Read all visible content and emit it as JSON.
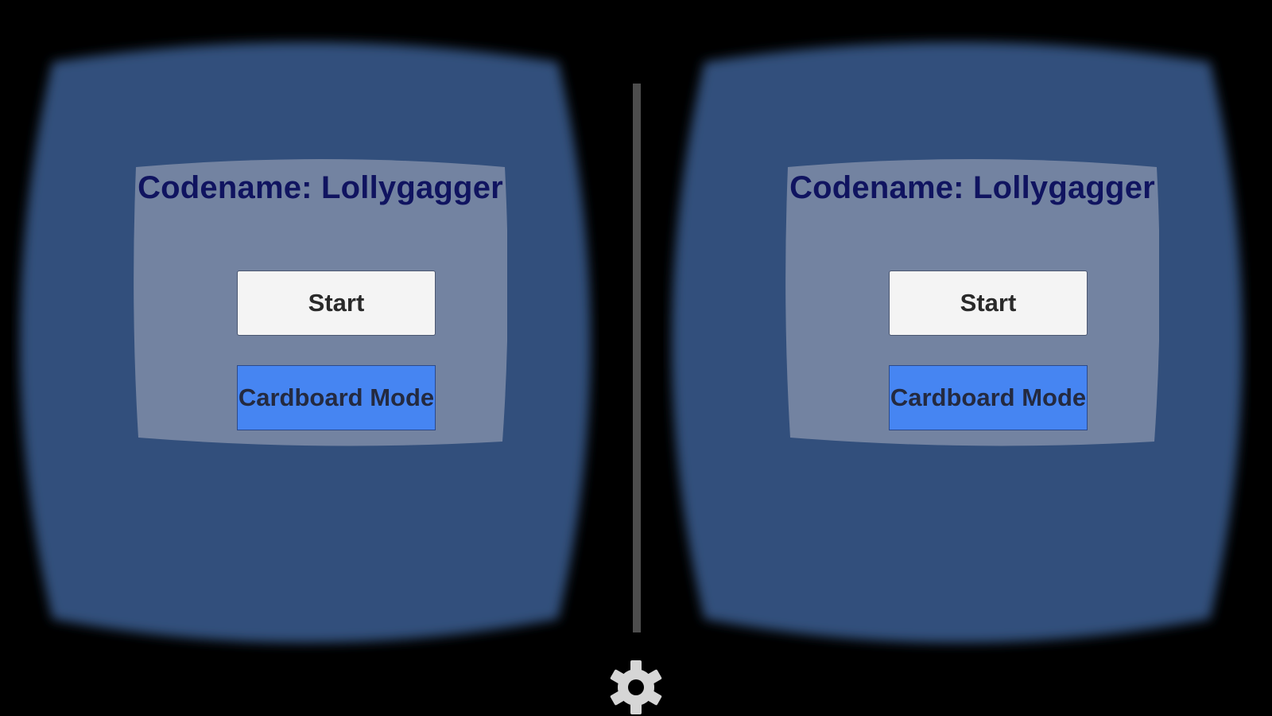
{
  "app": {
    "title": "Codename: Lollygagger"
  },
  "menu": {
    "start_label": "Start",
    "cardboard_label": "Cardboard Mode"
  },
  "icons": {
    "settings": "gear-icon"
  },
  "colors": {
    "lens_fill": "#314f7c",
    "panel_fill": "#7383a1",
    "title_text": "#101460",
    "start_button": "#f4f4f4",
    "cardboard_button": "#4685f2",
    "divider": "#4d4d4d",
    "gear": "#d6d6d6"
  }
}
